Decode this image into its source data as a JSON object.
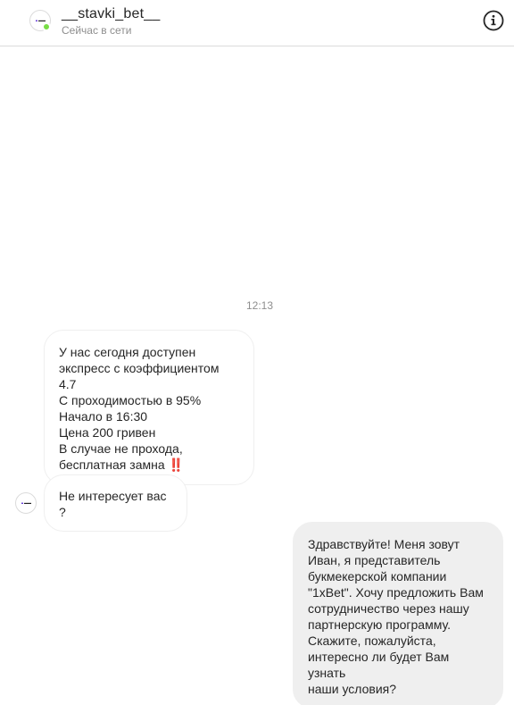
{
  "header": {
    "username": "__stavki_bet__",
    "status": "Сейчас в сети",
    "avatar_icon": "brand-logo-icon",
    "info_icon": "info-icon",
    "online_color": "#78de45"
  },
  "chat": {
    "timestamp": "12:13",
    "messages": [
      {
        "side": "incoming",
        "text": "У нас сегодня доступен\nэкспресс с коэффициентом 4.7\nС проходимостью в 95%\nНачало в 16:30\nЦена 200 гривен\nВ случае не прохода,\nбесплатная замна ",
        "emoji": "‼️"
      },
      {
        "side": "incoming",
        "text": "Не интересует вас ?"
      },
      {
        "side": "outgoing",
        "text": "Здравствуйте! Меня зовут\nИван, я представитель\nбукмекерской компании\n\"1xBet\". Хочу предложить Вам\nсотрудничество через нашу\nпартнерскую программу.\nСкажите, пожалуйста,\nинтересно ли будет Вам узнать\nнаши условия?"
      }
    ]
  }
}
